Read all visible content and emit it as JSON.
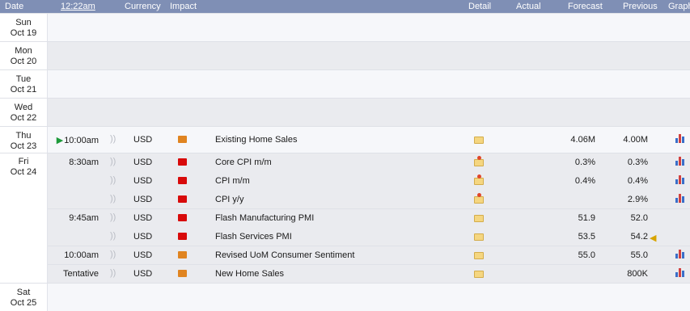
{
  "header": {
    "date": "Date",
    "time": "12:22am",
    "currency": "Currency",
    "impact": "Impact",
    "detail": "Detail",
    "actual": "Actual",
    "forecast": "Forecast",
    "previous": "Previous",
    "graph": "Graph"
  },
  "days": [
    {
      "dow": "Sun",
      "date": "Oct 19"
    },
    {
      "dow": "Mon",
      "date": "Oct 20"
    },
    {
      "dow": "Tue",
      "date": "Oct 21"
    },
    {
      "dow": "Wed",
      "date": "Oct 22"
    },
    {
      "dow": "Thu",
      "date": "Oct 23"
    },
    {
      "dow": "Fri",
      "date": "Oct 24"
    },
    {
      "dow": "Sat",
      "date": "Oct 25"
    }
  ],
  "events": [
    {
      "time": "10:00am",
      "next_up": true,
      "currency": "USD",
      "impact": "medium",
      "name": "Existing Home Sales",
      "detail_icon": "folder-icon",
      "actual": "",
      "forecast": "4.06M",
      "previous": "4.00M",
      "graph": true
    },
    {
      "time": "8:30am",
      "currency": "USD",
      "impact": "high",
      "name": "Core CPI m/m",
      "detail_icon": "folder-star-icon",
      "actual": "",
      "forecast": "0.3%",
      "previous": "0.3%",
      "graph": true
    },
    {
      "time": "",
      "currency": "USD",
      "impact": "high",
      "name": "CPI m/m",
      "detail_icon": "folder-star-icon",
      "actual": "",
      "forecast": "0.4%",
      "previous": "0.4%",
      "graph": true
    },
    {
      "time": "",
      "currency": "USD",
      "impact": "high",
      "name": "CPI y/y",
      "detail_icon": "folder-star-icon",
      "actual": "",
      "forecast": "",
      "previous": "2.9%",
      "graph": true
    },
    {
      "time": "9:45am",
      "currency": "USD",
      "impact": "high",
      "name": "Flash Manufacturing PMI",
      "detail_icon": "folder-icon",
      "actual": "",
      "forecast": "51.9",
      "previous": "52.0",
      "graph": false
    },
    {
      "time": "",
      "currency": "USD",
      "impact": "high",
      "name": "Flash Services PMI",
      "detail_icon": "folder-icon",
      "actual": "",
      "forecast": "53.5",
      "previous": "54.2",
      "revised": true,
      "graph": false
    },
    {
      "time": "10:00am",
      "currency": "USD",
      "impact": "medium",
      "name": "Revised UoM Consumer Sentiment",
      "detail_icon": "folder-icon",
      "actual": "",
      "forecast": "55.0",
      "previous": "55.0",
      "graph": true
    },
    {
      "time": "Tentative",
      "currency": "USD",
      "impact": "medium",
      "name": "New Home Sales",
      "detail_icon": "folder-icon",
      "actual": "",
      "forecast": "",
      "previous": "800K",
      "graph": true
    }
  ],
  "colors": {
    "header_bg": "#7f8fb5",
    "impact_high": "#d80a0a",
    "impact_medium": "#e08420",
    "next_event_marker": "#1d9a3a"
  }
}
